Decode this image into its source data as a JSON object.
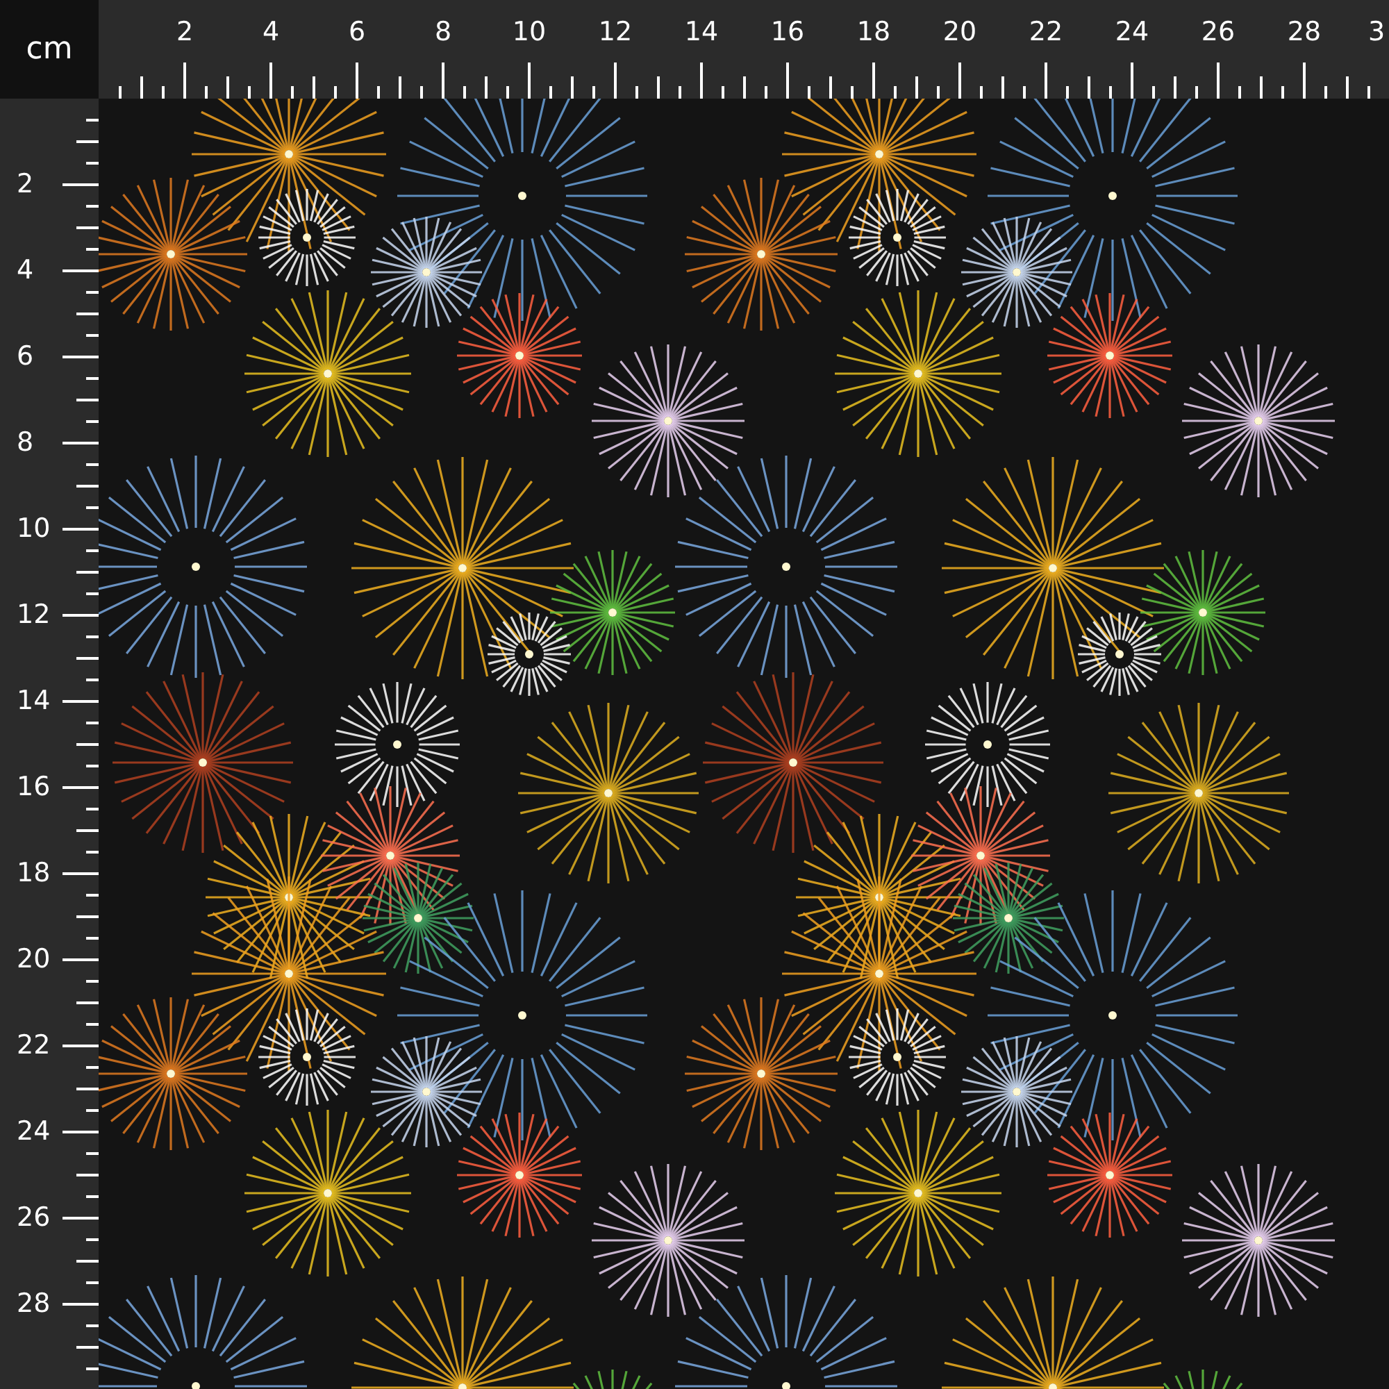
{
  "unit_label": "cm",
  "top_ruler": {
    "labels": [
      "2",
      "4",
      "6",
      "8",
      "10",
      "12",
      "14",
      "16",
      "18",
      "20",
      "22",
      "24",
      "26",
      "28",
      "3"
    ]
  },
  "left_ruler": {
    "labels": [
      "2",
      "4",
      "6",
      "8",
      "10",
      "12",
      "14",
      "16",
      "18",
      "20",
      "22",
      "24",
      "26",
      "28"
    ]
  }
}
